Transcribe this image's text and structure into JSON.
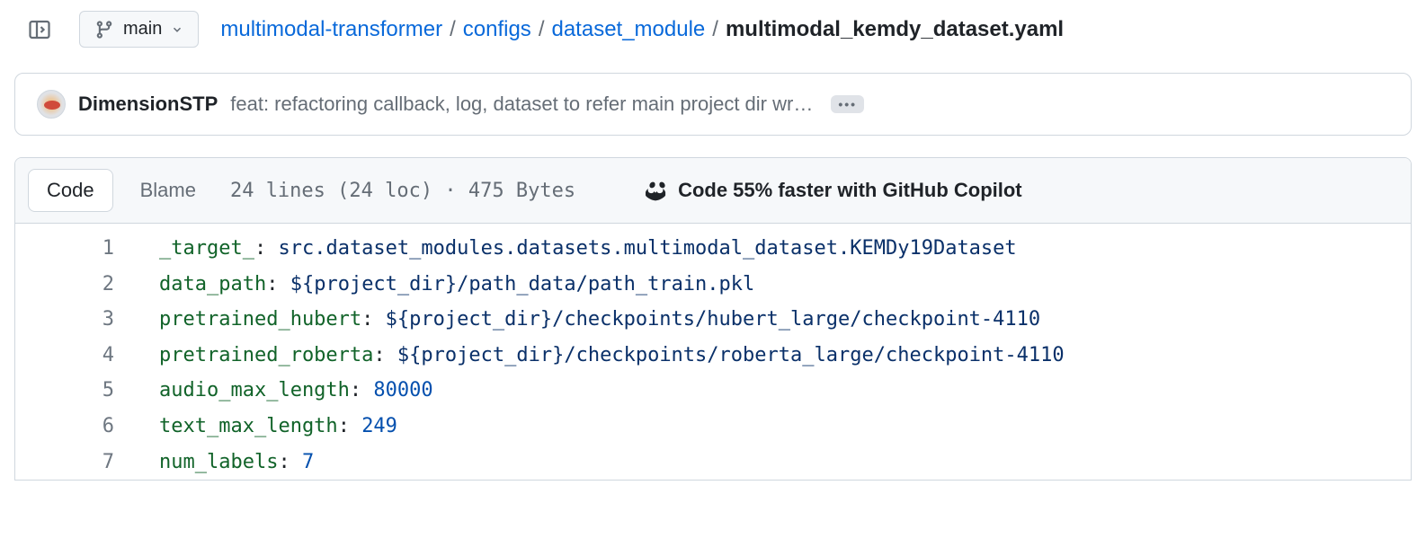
{
  "header": {
    "branch": "main",
    "breadcrumb": {
      "repo": "multimodal-transformer",
      "folder1": "configs",
      "folder2": "dataset_module",
      "file": "multimodal_kemdy_dataset.yaml"
    }
  },
  "commit": {
    "author": "DimensionSTP",
    "message": "feat: refactoring callback, log, dataset to refer main project dir wr…"
  },
  "file_header": {
    "tab_code": "Code",
    "tab_blame": "Blame",
    "meta": "24 lines (24 loc) · 475 Bytes",
    "copilot_promo": "Code 55% faster with GitHub Copilot"
  },
  "code": {
    "lines": [
      {
        "num": 1,
        "key": "_target_",
        "val": "src.dataset_modules.datasets.multimodal_dataset.KEMDy19Dataset",
        "type": "str"
      },
      {
        "num": 2,
        "key": "data_path",
        "val": "${project_dir}/path_data/path_train.pkl",
        "type": "str"
      },
      {
        "num": 3,
        "key": "pretrained_hubert",
        "val": "${project_dir}/checkpoints/hubert_large/checkpoint-4110",
        "type": "str"
      },
      {
        "num": 4,
        "key": "pretrained_roberta",
        "val": "${project_dir}/checkpoints/roberta_large/checkpoint-4110",
        "type": "str"
      },
      {
        "num": 5,
        "key": "audio_max_length",
        "val": "80000",
        "type": "num"
      },
      {
        "num": 6,
        "key": "text_max_length",
        "val": "249",
        "type": "num"
      },
      {
        "num": 7,
        "key": "num_labels",
        "val": "7",
        "type": "num"
      }
    ]
  }
}
